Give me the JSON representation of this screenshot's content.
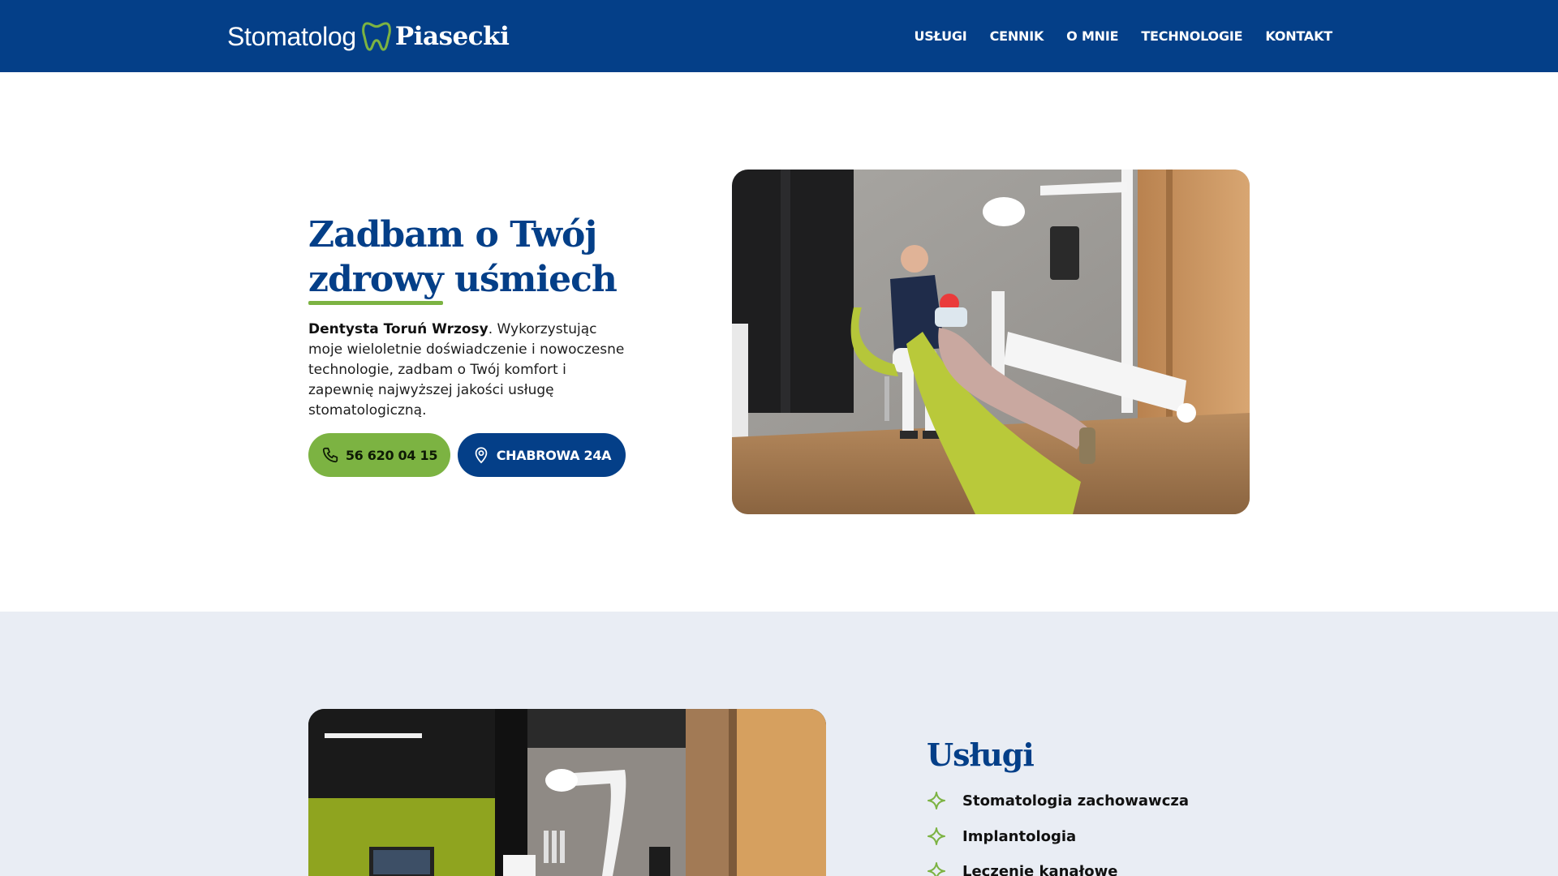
{
  "header": {
    "logo_light": "Stomatolog",
    "logo_bold": "Piasecki",
    "nav": [
      "USŁUGI",
      "CENNIK",
      "O MNIE",
      "TECHNOLOGIE",
      "KONTAKT"
    ]
  },
  "hero": {
    "title_line1": "Zadbam o Twój",
    "title_underlined": "zdrowy",
    "title_rest": " uśmiech",
    "text_bold": "Dentysta Toruń Wrzosy",
    "text_rest": ". Wykorzystując moje wieloletnie doświadczenie i nowoczesne technologie, zadbam o Twój komfort i zapewnię najwyższej jakości usługę stomatologiczną.",
    "phone_label": "56 620 04 15",
    "address_label": "CHABROWA 24A"
  },
  "services": {
    "title": "Usługi",
    "items": [
      "Stomatologia zachowawcza",
      "Implantologia",
      "Leczenie kanałowe"
    ]
  },
  "colors": {
    "brand_blue": "#043f88",
    "accent_green": "#7cb342",
    "section_bg": "#e9edf4"
  },
  "icons": {
    "phone": "phone-icon",
    "location": "location-pin-icon",
    "logo": "tooth-icon",
    "bullet": "sparkle-star-icon"
  }
}
